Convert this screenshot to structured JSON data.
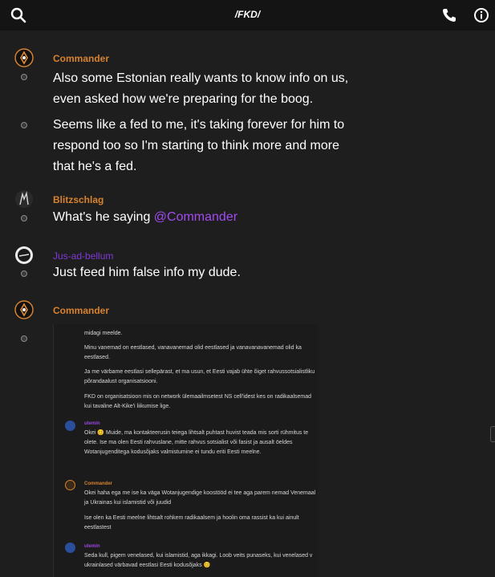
{
  "header": {
    "title": "/FKD/",
    "icons": {
      "search": "search-icon",
      "call": "phone-icon",
      "info": "info-icon"
    }
  },
  "messages": [
    {
      "username": "Commander",
      "lines": [
        "Also some Estonian really wants to know info on us, even asked how we're preparing for the boog.",
        "Seems like a fed to me, it's taking forever for him to respond too so I'm starting to think more and more that he's a fed."
      ]
    },
    {
      "username": "Blitzschlag",
      "text": "What's he saying ",
      "mention": "@Commander"
    },
    {
      "username": "Jus-ad-bellum",
      "text": "Just feed him false info my dude."
    },
    {
      "username": "Commander"
    }
  ],
  "embed": {
    "paragraphs": [
      "midagi meelde.",
      "Minu vanemad on eestlased, vanavanemad olid eestlased ja vanavanavanemad olid ka eestlased.",
      "Ja me värbame eestlasi sellepärast, et ma usun, et Eesti vajab ühte õiget rahvussotsialistliku põrandaalust organisatsiooni.",
      "FKD on organisatsioon mis on network ülemaailmsetest NS cell'idest kes on radikaalsemad kui tavaline Alt-Kike'i liikumise lige."
    ],
    "reply1_name": "utemin",
    "reply1_text": "Okei 😊 Muide, ma kontakteerusin teiega lihtsalt puhtast huvist teada mis sorti rühmitus te olete. Ise ma olen Eesti rahvuslane, mitte rahvus sotsialist või fasist ja ausalt öeldes Wotanjugenditega kodusõjaks valmistumine ei tundu eriti Eesti meelne.",
    "reply2_name": "Commander",
    "reply2_text_a": "Okei haha ega me ise ka väga Wotanjugendige koostööd ei tee aga parem nemad Venemaal ja Ukrainas kui islamistid või juudid",
    "reply2_text_b": "Ise olen ka Eesti meelne lihtsalt rohkem radikaalsem ja hoolin oma rassist ka kui ainult eestlastest",
    "reply3_name": "utemin",
    "reply3_text": "Seda kull, pigem venelased, kui islamistid, aga ikkagi. Loob veits punaseks, kui venelased v ukrainlased värbavad eestlasi Eesti kodusõjaks 😊"
  },
  "colors": {
    "orange_name": "#d7822e",
    "purple_name": "#7e3ad6",
    "mention": "#a24bf0",
    "background": "#1e1e1e",
    "header": "#141414"
  }
}
